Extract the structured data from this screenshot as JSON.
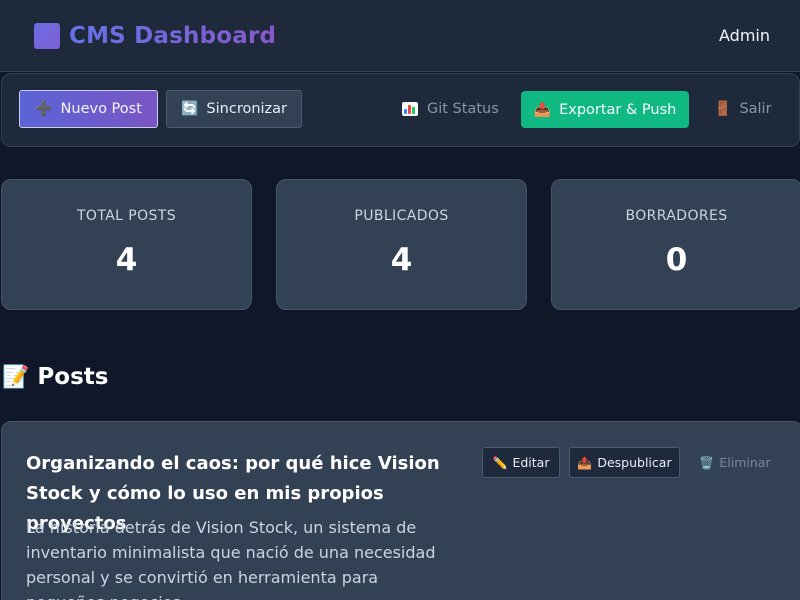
{
  "header": {
    "title": "CMS Dashboard",
    "user": "Admin",
    "brand_icon": "purple-square-icon"
  },
  "toolbar": {
    "new_post": {
      "label": "Nuevo Post",
      "icon": "plus-icon"
    },
    "sync": {
      "label": "Sincronizar",
      "icon": "sync-icon"
    },
    "git_status": {
      "label": "Git Status",
      "icon": "bar-chart-icon"
    },
    "export_push": {
      "label": "Exportar & Push",
      "icon": "outbox-icon"
    },
    "exit": {
      "label": "Salir",
      "icon": "door-icon"
    }
  },
  "stats": [
    {
      "label": "TOTAL POSTS",
      "value": "4"
    },
    {
      "label": "PUBLICADOS",
      "value": "4"
    },
    {
      "label": "BORRADORES",
      "value": "0"
    }
  ],
  "posts_section": {
    "title": "Posts",
    "icon": "memo-icon"
  },
  "posts": [
    {
      "title": "Organizando el caos: por qué hice Vision Stock y cómo lo uso en mis propios proyectos",
      "description": "La historia detrás de Vision Stock, un sistema de inventario minimalista que nació de una necesidad personal y se convirtió en herramienta para pequeños negocios.",
      "actions": {
        "edit": "Editar",
        "unpublish": "Despublicar",
        "delete": "Eliminar"
      }
    }
  ],
  "colors": {
    "background": "#0f1729",
    "panel": "#1e293b",
    "card": "#334155",
    "accent_start": "#5b64d6",
    "accent_end": "#7b55c4",
    "success": "#10b981"
  }
}
